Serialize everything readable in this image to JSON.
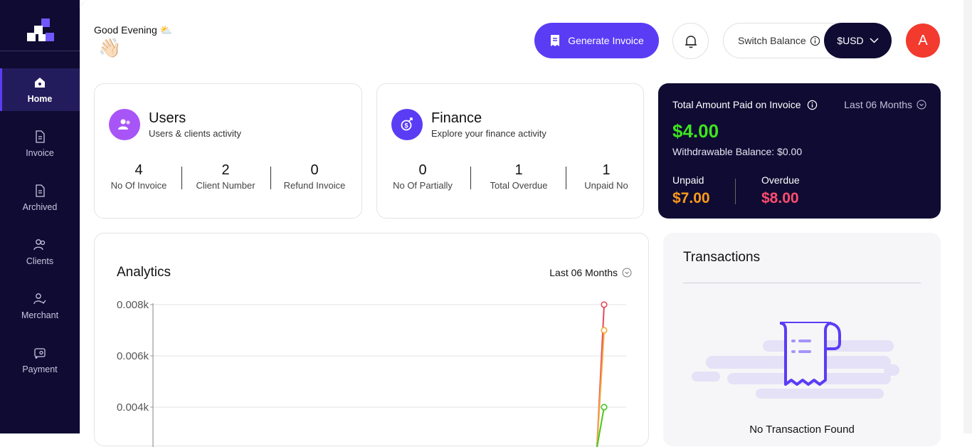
{
  "sidebar": {
    "items": [
      {
        "label": "Home",
        "icon": "home-icon",
        "active": true
      },
      {
        "label": "Invoice",
        "icon": "invoice-icon"
      },
      {
        "label": "Archived",
        "icon": "archive-icon"
      },
      {
        "label": "Clients",
        "icon": "clients-icon"
      },
      {
        "label": "Merchant",
        "icon": "merchant-icon"
      },
      {
        "label": "Payment",
        "icon": "payment-icon"
      }
    ]
  },
  "header": {
    "greeting": "Good Evening ⛅",
    "wave_emoji": "👋🏻",
    "generate_label": "Generate Invoice",
    "switch_label": "Switch Balance",
    "currency": "$USD",
    "avatar_letter": "A"
  },
  "users_card": {
    "title": "Users",
    "subtitle": "Users & clients activity",
    "stats": [
      {
        "value": "4",
        "label": "No Of Invoice"
      },
      {
        "value": "2",
        "label": "Client Number"
      },
      {
        "value": "0",
        "label": "Refund Invoice"
      }
    ]
  },
  "finance_card": {
    "title": "Finance",
    "subtitle": "Explore your finance activity",
    "stats": [
      {
        "value": "0",
        "label": "No Of Partially"
      },
      {
        "value": "1",
        "label": "Total Overdue"
      },
      {
        "value": "1",
        "label": "Unpaid No"
      }
    ]
  },
  "paid_card": {
    "title": "Total Amount Paid on Invoice",
    "period": "Last 06 Months",
    "amount": "$4.00",
    "withdrawable": "Withdrawable Balance: $0.00",
    "unpaid_label": "Unpaid",
    "unpaid_value": "$7.00",
    "overdue_label": "Overdue",
    "overdue_value": "$8.00"
  },
  "analytics": {
    "title": "Analytics",
    "period": "Last 06 Months"
  },
  "chart_data": {
    "type": "line",
    "title": "",
    "yticks": [
      "0.008k",
      "0.006k",
      "0.004k"
    ],
    "ylim": [
      0,
      0.008
    ],
    "series": [
      {
        "color": "#e8475b",
        "values": [
          0,
          0,
          0,
          0,
          0,
          0.008
        ]
      },
      {
        "color": "#f2a93b",
        "values": [
          0,
          0,
          0,
          0,
          0,
          0.007
        ]
      },
      {
        "color": "#45c81f",
        "values": [
          0,
          0,
          0,
          0,
          0,
          0.004
        ]
      }
    ]
  },
  "transactions": {
    "title": "Transactions",
    "empty_text": "No Transaction Found"
  },
  "colors": {
    "accent": "#5b3cf5",
    "navy": "#0f0b33",
    "green": "#3ee51f",
    "orange": "#ff9b1a",
    "red": "#ff4d6d",
    "avatar": "#f23a2e"
  }
}
